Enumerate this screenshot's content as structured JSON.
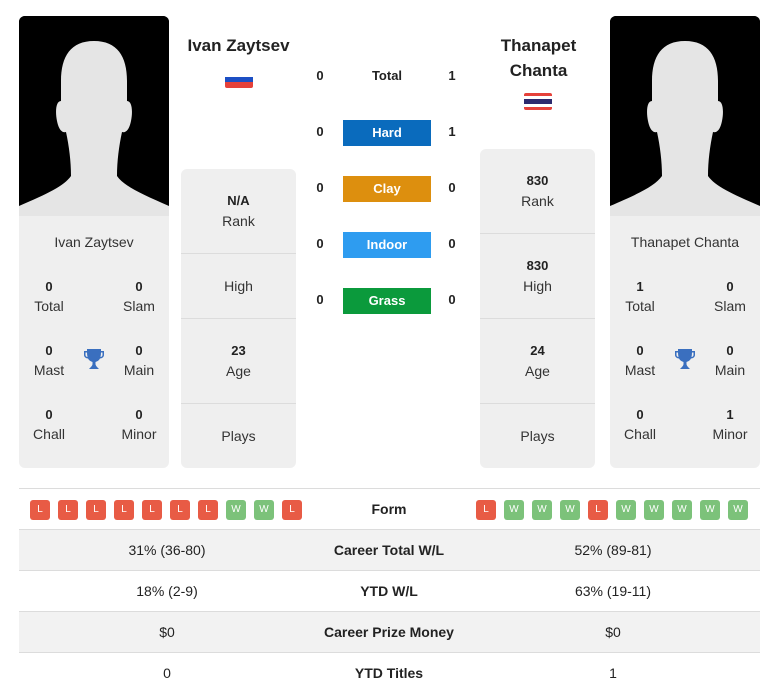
{
  "players": [
    {
      "name": "Ivan Zaytsev",
      "header_name_lines": [
        "Ivan Zaytsev"
      ],
      "flag": "russia-flag",
      "titles": {
        "total": {
          "value": "0",
          "label": "Total"
        },
        "slam": {
          "value": "0",
          "label": "Slam"
        },
        "mast": {
          "value": "0",
          "label": "Mast"
        },
        "main": {
          "value": "0",
          "label": "Main"
        },
        "chall": {
          "value": "0",
          "label": "Chall"
        },
        "minor": {
          "value": "0",
          "label": "Minor"
        }
      },
      "rank": {
        "value": "N/A",
        "label": "Rank"
      },
      "high": {
        "value": "",
        "label": "High"
      },
      "age": {
        "value": "23",
        "label": "Age"
      },
      "plays": {
        "value": "",
        "label": "Plays"
      },
      "form": [
        "L",
        "L",
        "L",
        "L",
        "L",
        "L",
        "L",
        "W",
        "W",
        "L"
      ]
    },
    {
      "name": "Thanapet Chanta",
      "header_name_lines": [
        "Thanapet",
        "Chanta"
      ],
      "flag": "thailand-flag",
      "titles": {
        "total": {
          "value": "1",
          "label": "Total"
        },
        "slam": {
          "value": "0",
          "label": "Slam"
        },
        "mast": {
          "value": "0",
          "label": "Mast"
        },
        "main": {
          "value": "0",
          "label": "Main"
        },
        "chall": {
          "value": "0",
          "label": "Chall"
        },
        "minor": {
          "value": "1",
          "label": "Minor"
        }
      },
      "rank": {
        "value": "830",
        "label": "Rank"
      },
      "high": {
        "value": "830",
        "label": "High"
      },
      "age": {
        "value": "24",
        "label": "Age"
      },
      "plays": {
        "value": "",
        "label": "Plays"
      },
      "form": [
        "L",
        "W",
        "W",
        "W",
        "L",
        "W",
        "W",
        "W",
        "W",
        "W"
      ]
    }
  ],
  "h2h": {
    "total": {
      "label": "Total",
      "left": "0",
      "right": "1"
    },
    "surfaces": [
      {
        "label": "Hard",
        "left": "0",
        "right": "1",
        "color": "#0a6bbd"
      },
      {
        "label": "Clay",
        "left": "0",
        "right": "0",
        "color": "#dd8f0e"
      },
      {
        "label": "Indoor",
        "left": "0",
        "right": "0",
        "color": "#2e9cf0"
      },
      {
        "label": "Grass",
        "left": "0",
        "right": "0",
        "color": "#0b9a3c"
      }
    ]
  },
  "form_label": "Form",
  "stats": [
    {
      "label": "Career Total W/L",
      "left": "31% (36-80)",
      "right": "52% (89-81)"
    },
    {
      "label": "YTD W/L",
      "left": "18% (2-9)",
      "right": "63% (19-11)"
    },
    {
      "label": "Career Prize Money",
      "left": "$0",
      "right": "$0"
    },
    {
      "label": "YTD Titles",
      "left": "0",
      "right": "1"
    }
  ],
  "colors": {
    "loss": "#e85b45",
    "win": "#7cc27a",
    "trophy": "#3a6fbf",
    "card_bg": "#efefef"
  }
}
